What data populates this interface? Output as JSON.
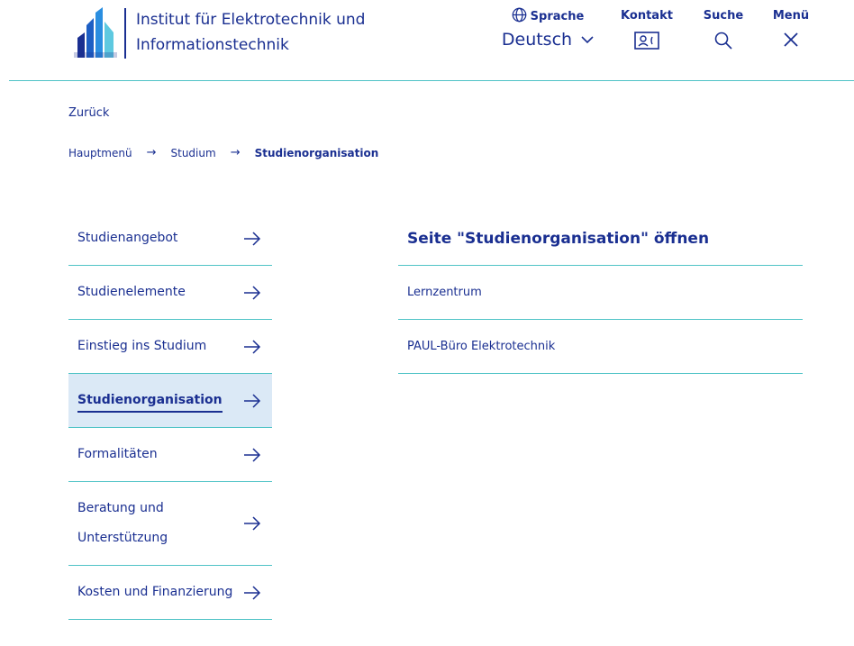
{
  "header": {
    "institute_line1": "Institut für Elektrotechnik und",
    "institute_line2": "Informationstechnik",
    "language": {
      "label": "Sprache",
      "value": "Deutsch"
    },
    "contact": {
      "label": "Kontakt"
    },
    "search": {
      "label": "Suche"
    },
    "menu": {
      "label": "Menü"
    }
  },
  "back_link": "Zurück",
  "breadcrumb": [
    "Hauptmenü",
    "Studium",
    "Studienorganisation"
  ],
  "nav": {
    "items": [
      {
        "label": "Studienangebot"
      },
      {
        "label": "Studienelemente"
      },
      {
        "label": "Einstieg ins Studium"
      },
      {
        "label": "Studienorganisation",
        "active": true
      },
      {
        "label": "Formalitäten"
      },
      {
        "label_line1": "Beratung und",
        "label_line2": "Unterstützung"
      },
      {
        "label": "Kosten und Finanzierung"
      }
    ]
  },
  "panel": {
    "title": "Seite \"Studienorganisation\" öffnen",
    "items": [
      "Lernzentrum",
      "PAUL-Büro Elektrotechnik"
    ]
  },
  "colors": {
    "primary": "#1a2f91",
    "accent_line": "#4fc3c6",
    "active_bg": "#dbe9f6"
  },
  "icons": [
    "university-logo-icon",
    "globe-icon",
    "chevron-down-icon",
    "contact-card-icon",
    "search-icon",
    "close-icon",
    "arrow-right-icon"
  ]
}
